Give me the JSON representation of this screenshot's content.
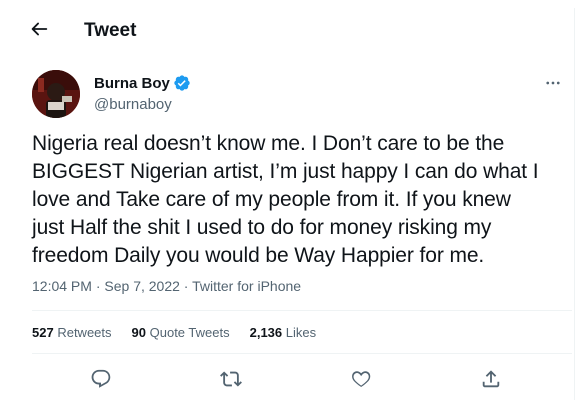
{
  "header": {
    "title": "Tweet"
  },
  "author": {
    "name": "Burna Boy",
    "handle": "@burnaboy"
  },
  "tweet": {
    "lines": [
      "Nigeria real doesn’t know me. I Don’t care to be the",
      "BIGGEST Nigerian artist, I’m just happy I can do what I",
      "love and Take care of my people from it. If you knew",
      "just Half the shit I used to do for money risking my",
      "freedom Daily you would be Way Happier for me."
    ]
  },
  "meta": {
    "time": "12:04 PM",
    "separator": " · ",
    "date": "Sep 7, 2022",
    "source": "Twitter for iPhone"
  },
  "stats": {
    "retweets_count": "527",
    "retweets_label": "Retweets",
    "quotes_count": "90",
    "quotes_label": "Quote Tweets",
    "likes_count": "2,136",
    "likes_label": "Likes"
  },
  "icons": {
    "back": "back-arrow-icon",
    "verified": "verified-badge-icon",
    "more": "more-options-icon",
    "reply": "reply-icon",
    "retweet": "retweet-icon",
    "like": "like-icon",
    "share": "share-icon"
  },
  "colors": {
    "text": "#0f1419",
    "secondary": "#536471",
    "verified": "#1d9bf0",
    "divider": "#eff3f4"
  }
}
